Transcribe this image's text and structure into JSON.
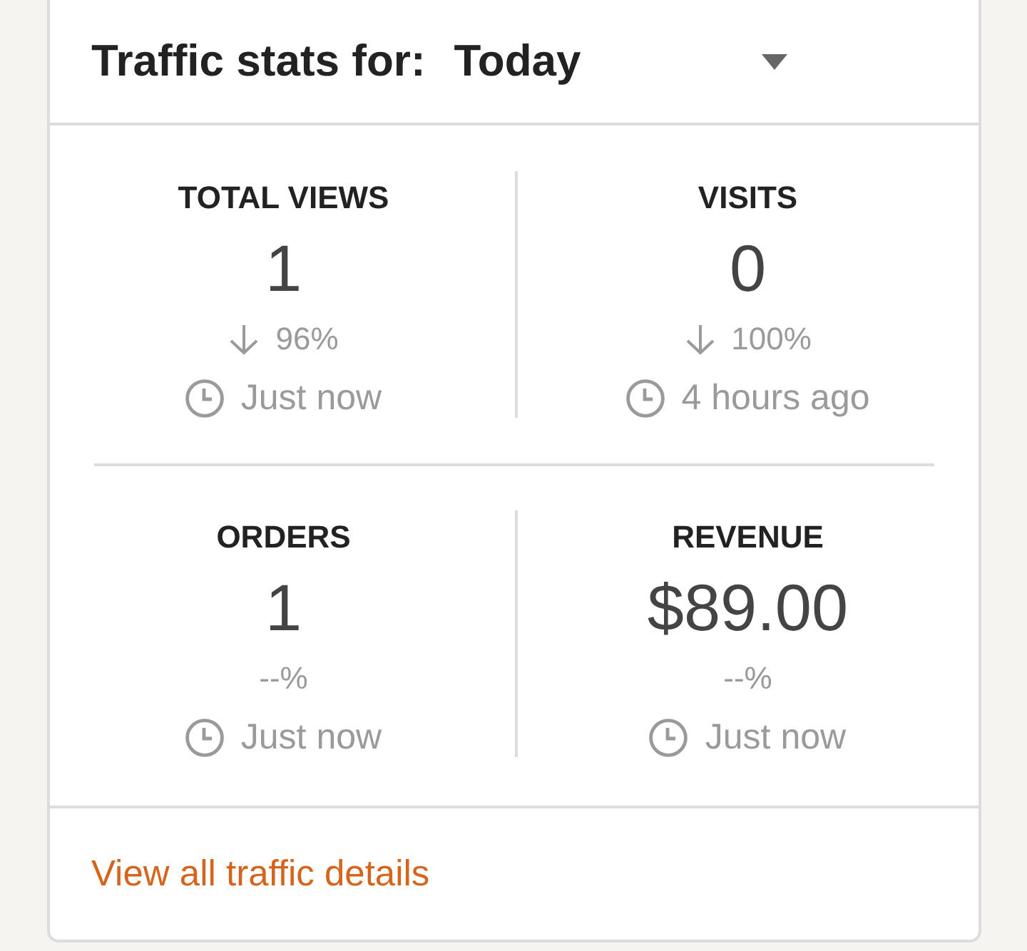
{
  "header": {
    "title": "Traffic stats for:",
    "period": "Today"
  },
  "stats": [
    {
      "label": "TOTAL VIEWS",
      "value": "1",
      "decreased": true,
      "change": "96%",
      "updated": "Just now"
    },
    {
      "label": "VISITS",
      "value": "0",
      "decreased": true,
      "change": "100%",
      "updated": "4 hours ago"
    },
    {
      "label": "ORDERS",
      "value": "1",
      "decreased": false,
      "change": "--%",
      "updated": "Just now"
    },
    {
      "label": "REVENUE",
      "value": "$89.00",
      "decreased": false,
      "change": "--%",
      "updated": "Just now"
    }
  ],
  "footer": {
    "link": "View all traffic details"
  }
}
